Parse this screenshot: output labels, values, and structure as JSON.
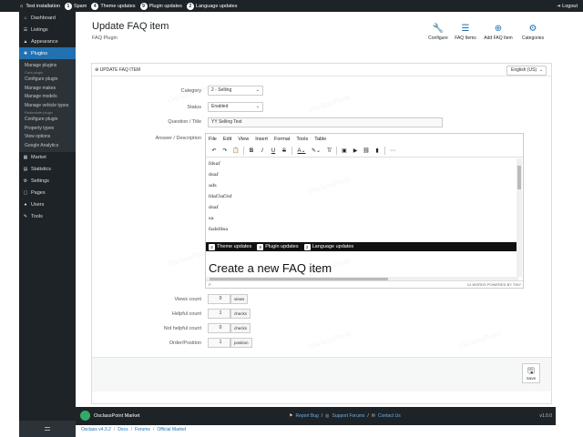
{
  "topbar": {
    "site": "Test installation",
    "items": [
      {
        "badge": "1",
        "label": "Spam"
      },
      {
        "badge": "4",
        "label": "Theme updates"
      },
      {
        "badge": "9",
        "label": "Plugin updates"
      },
      {
        "badge": "2",
        "label": "Language updates"
      }
    ],
    "logout": "Logout"
  },
  "sidebar": {
    "items_top": [
      {
        "icon": "⌂",
        "label": "Dashboard"
      },
      {
        "icon": "☰",
        "label": "Listings"
      },
      {
        "icon": "▲",
        "label": "Appearance"
      },
      {
        "icon": "✚",
        "label": "Plugins"
      }
    ],
    "submenu": [
      {
        "label": "Manage plugins",
        "head": false
      },
      {
        "label": "Cars plugin",
        "head": true
      },
      {
        "label": "Configure plugin",
        "head": false
      },
      {
        "label": "Manage makes",
        "head": false
      },
      {
        "label": "Manage models",
        "head": false
      },
      {
        "label": "Manage vehicle types",
        "head": false
      },
      {
        "label": "Realestate plugin",
        "head": true
      },
      {
        "label": "Configure plugin",
        "head": false
      },
      {
        "label": "Property types",
        "head": false
      },
      {
        "label": "View options",
        "head": false
      },
      {
        "label": "Google Analytics",
        "head": false
      }
    ],
    "items_bottom": [
      {
        "icon": "▦",
        "label": "Market"
      },
      {
        "icon": "▤",
        "label": "Statistics"
      },
      {
        "icon": "⚙",
        "label": "Settings"
      },
      {
        "icon": "▢",
        "label": "Pages"
      },
      {
        "icon": "●",
        "label": "Users"
      },
      {
        "icon": "✎",
        "label": "Tools"
      }
    ]
  },
  "header": {
    "title": "Update FAQ item",
    "subtitle": "FAQ Plugin",
    "actions": [
      {
        "icon": "wrench-icon",
        "glyph": "🔧",
        "label": "Configure"
      },
      {
        "icon": "list-icon",
        "glyph": "☰",
        "label": "FAQ Items"
      },
      {
        "icon": "plus-circle-icon",
        "glyph": "⊕",
        "label": "Add FAQ Item"
      },
      {
        "icon": "cogs-icon",
        "glyph": "⚙",
        "label": "Categories"
      }
    ]
  },
  "panel": {
    "head": "⊕ UPDATE FAQ ITEM",
    "language": "English (US)"
  },
  "form": {
    "category_label": "Category",
    "category_value": "2 - Selling",
    "status_label": "Status",
    "status_value": "Enabled",
    "question_label": "Question / Title",
    "question_value": "YY Selling Test",
    "answer_label": "Answer / Description",
    "views_label": "Views count",
    "views_value": "0",
    "views_unit": "views",
    "helpful_label": "Helpful count",
    "helpful_value": "1",
    "helpful_unit": "checks",
    "nothelpful_label": "Not helpful count",
    "nothelpful_value": "0",
    "nothelpful_unit": "checks",
    "order_label": "Order/Position",
    "order_value": "1",
    "order_unit": "position"
  },
  "editor": {
    "menu": [
      "File",
      "Edit",
      "View",
      "Insert",
      "Format",
      "Tools",
      "Table"
    ],
    "lines": [
      "fdsaf",
      "dsaf",
      "ads",
      "fdaf3af3sf",
      "dsaf",
      "sa",
      "fadsfdsa"
    ],
    "embed_items": [
      {
        "badge": "4",
        "label": "Theme updates"
      },
      {
        "badge": "9",
        "label": "Plugin updates"
      },
      {
        "badge": "2",
        "label": "Language updates"
      }
    ],
    "heading": "Create a new FAQ item",
    "status_left": "P",
    "status_right": "14 WORDS   POWERED BY TINY"
  },
  "save": {
    "label": "Save"
  },
  "footer": {
    "brand": "OsclassPoint Market",
    "report_bug": "Report Bug",
    "support": "Support Forums",
    "contact": "Contact Us",
    "version": "v1.0.0"
  },
  "breadcrumb": [
    "Osclass v4.3.2",
    "Docs",
    "Forums",
    "Official Market"
  ],
  "watermark": "OsclassPoint"
}
